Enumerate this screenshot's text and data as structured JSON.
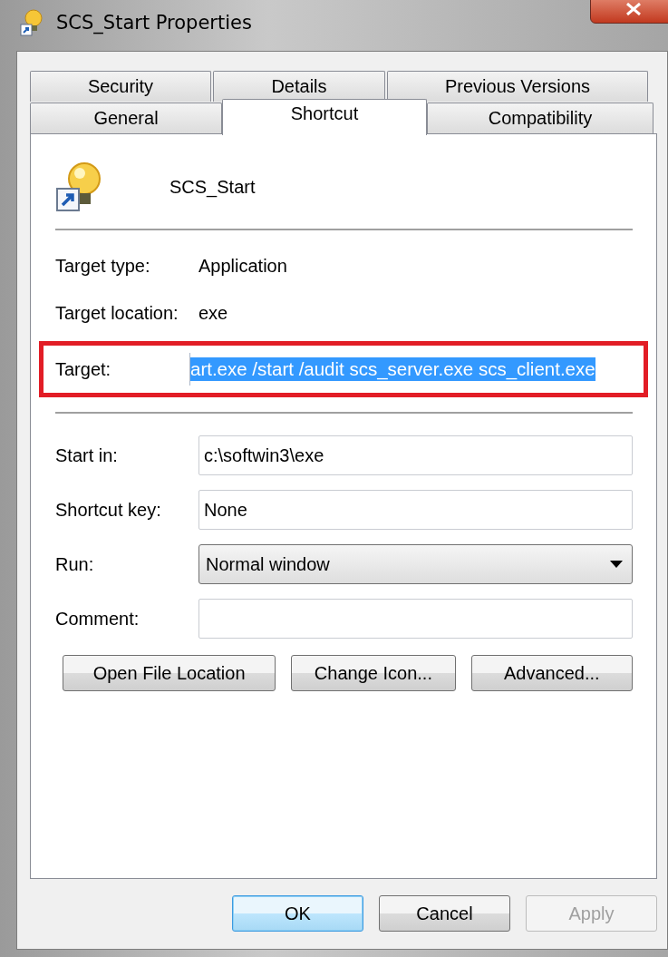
{
  "window": {
    "title": "SCS_Start Properties"
  },
  "tab_rows": [
    [
      {
        "label": "Security",
        "selected": false
      },
      {
        "label": "Details",
        "selected": false
      },
      {
        "label": "Previous Versions",
        "selected": false
      }
    ],
    [
      {
        "label": "General",
        "selected": false
      },
      {
        "label": "Shortcut",
        "selected": true
      },
      {
        "label": "Compatibility",
        "selected": false
      }
    ]
  ],
  "shortcut": {
    "name": "SCS_Start"
  },
  "info_rows": [
    {
      "label": "Target type:",
      "value": "Application"
    },
    {
      "label": "Target location:",
      "value": "exe"
    }
  ],
  "target": {
    "label": "Target:",
    "value": "art.exe /start /audit scs_server.exe scs_client.exe",
    "text_selected": true,
    "highlighted": true
  },
  "fields": [
    {
      "kind": "input",
      "label": "Start in:",
      "value": "c:\\softwin3\\exe"
    },
    {
      "kind": "input",
      "label": "Shortcut key:",
      "value": "None"
    },
    {
      "kind": "dropdown",
      "label": "Run:",
      "value": "Normal window"
    },
    {
      "kind": "input",
      "label": "Comment:"
    }
  ],
  "action_buttons": [
    "Open File Location",
    "Change Icon...",
    "Advanced..."
  ],
  "dialog_buttons": [
    {
      "label": "OK",
      "default": true,
      "disabled": false
    },
    {
      "label": "Cancel",
      "default": false,
      "disabled": false
    },
    {
      "label": "Apply",
      "default": false,
      "disabled": true
    }
  ]
}
